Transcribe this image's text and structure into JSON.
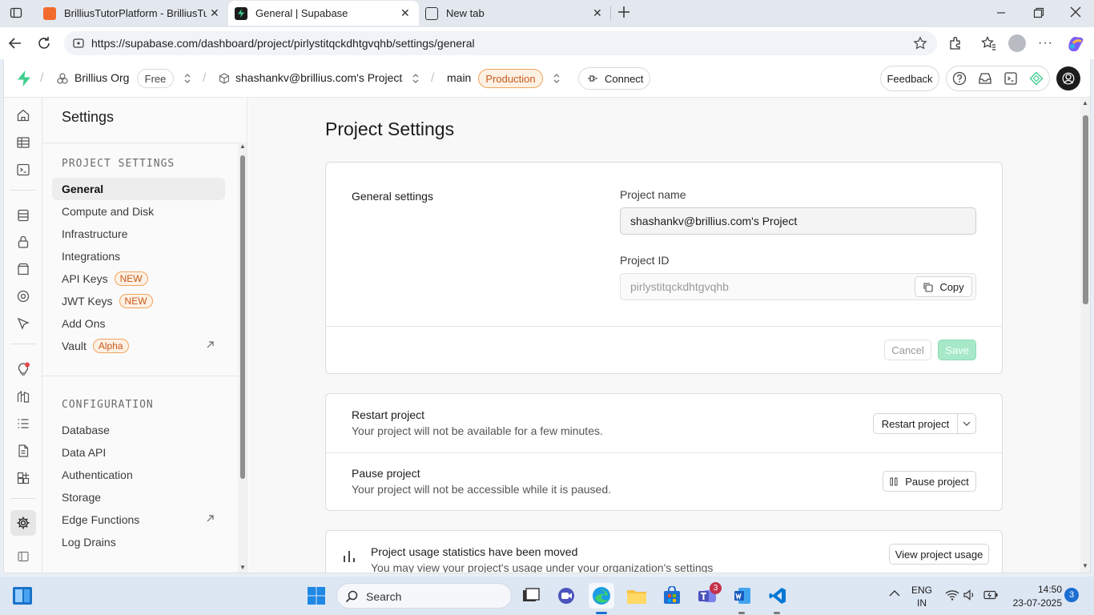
{
  "browser": {
    "tabs": [
      {
        "title": "BrilliusTutorPlatform - BrilliusTuto",
        "active": false
      },
      {
        "title": "General | Supabase",
        "active": true
      },
      {
        "title": "New tab",
        "active": false
      }
    ],
    "url": "https://supabase.com/dashboard/project/pirlystitqckdhtgvqhb/settings/general"
  },
  "topnav": {
    "org_name": "Brillius Org",
    "org_plan": "Free",
    "project_name": "shashankv@brillius.com's Project",
    "branch": "main",
    "branch_badge": "Production",
    "connect_label": "Connect",
    "feedback_label": "Feedback"
  },
  "sidebar": {
    "title": "Settings",
    "project_settings_header": "PROJECT SETTINGS",
    "project_items": [
      {
        "label": "General",
        "selected": true,
        "badge": ""
      },
      {
        "label": "Compute and Disk",
        "badge": ""
      },
      {
        "label": "Infrastructure",
        "badge": ""
      },
      {
        "label": "Integrations",
        "badge": ""
      },
      {
        "label": "API Keys",
        "badge": "NEW"
      },
      {
        "label": "JWT Keys",
        "badge": "NEW"
      },
      {
        "label": "Add Ons",
        "badge": ""
      },
      {
        "label": "Vault",
        "badge": "Alpha",
        "external": true
      }
    ],
    "configuration_header": "CONFIGURATION",
    "config_items": [
      {
        "label": "Database"
      },
      {
        "label": "Data API"
      },
      {
        "label": "Authentication"
      },
      {
        "label": "Storage"
      },
      {
        "label": "Edge Functions",
        "external": true
      },
      {
        "label": "Log Drains"
      }
    ]
  },
  "main": {
    "page_title": "Project Settings",
    "general": {
      "section_title": "General settings",
      "project_name_label": "Project name",
      "project_name_value": "shashankv@brillius.com's Project",
      "project_id_label": "Project ID",
      "project_id_value": "pirlystitqckdhtgvqhb",
      "copy_label": "Copy",
      "cancel_label": "Cancel",
      "save_label": "Save"
    },
    "restart": {
      "title": "Restart project",
      "desc": "Your project will not be available for a few minutes.",
      "button": "Restart project"
    },
    "pause": {
      "title": "Pause project",
      "desc": "Your project will not be accessible while it is paused.",
      "button": "Pause project"
    },
    "usage": {
      "title": "Project usage statistics have been moved",
      "desc": "You may view your project's usage under your organization's settings",
      "button": "View project usage"
    }
  },
  "taskbar": {
    "search_placeholder": "Search",
    "lang_line1": "ENG",
    "lang_line2": "IN",
    "time": "14:50",
    "date": "23-07-2025",
    "teams_badge": "3",
    "notif_count": "3"
  },
  "colors": {
    "brand_green": "#3ecf8e",
    "badge_orange": "#c9591c",
    "save_disabled": "#a7e8c8"
  }
}
